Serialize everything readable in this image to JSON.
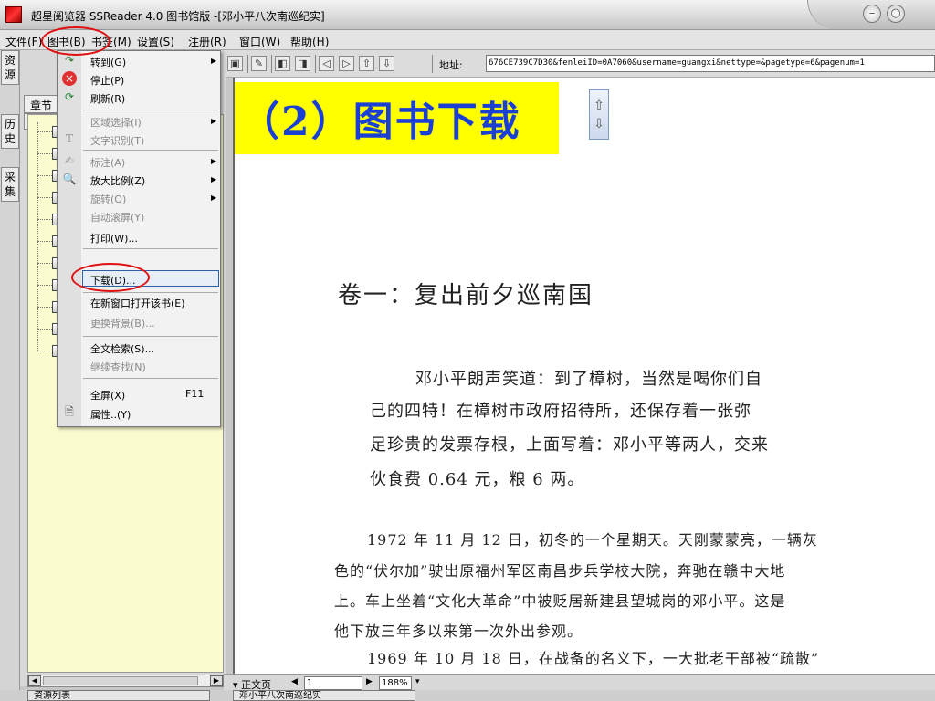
{
  "window": {
    "title": "超星阅览器 SSReader 4.0 图书馆版 -[邓小平八次南巡纪实]"
  },
  "menubar": {
    "items": [
      "文件(F)",
      "图书(B)",
      "书签(M)",
      "设置(S)",
      "注册(R)",
      "窗口(W)",
      "帮助(H)"
    ]
  },
  "toolbar": {
    "address_label": "地址:",
    "address_value": "676CE739C7D30&fenleiID=0A7060&username=guangxi&nettype=&pagetype=6&pagenum=1"
  },
  "left_strip": {
    "tabs": [
      "资源",
      "历史",
      "采集"
    ]
  },
  "left_panel": {
    "tab_label": "章节",
    "tab_label_2": "章节"
  },
  "dropdown": {
    "items": [
      {
        "label": "转到(G)",
        "disabled": false,
        "submenu": true,
        "icon": "go-to-icon"
      },
      {
        "label": "停止(P)",
        "disabled": false,
        "submenu": false,
        "icon": "stop-icon"
      },
      {
        "label": "刷新(R)",
        "disabled": false,
        "submenu": false,
        "icon": "refresh-icon"
      },
      {
        "label": "区域选择(I)",
        "disabled": true,
        "submenu": true,
        "icon": ""
      },
      {
        "label": "文字识别(T)",
        "disabled": true,
        "submenu": false,
        "icon": "text-recognition-icon"
      },
      {
        "label": "标注(A)",
        "disabled": true,
        "submenu": true,
        "icon": "annotate-icon"
      },
      {
        "label": "放大比例(Z)",
        "disabled": false,
        "submenu": true,
        "icon": "zoom-icon"
      },
      {
        "label": "旋转(O)",
        "disabled": true,
        "submenu": true,
        "icon": ""
      },
      {
        "label": "自动滚屏(Y)",
        "disabled": true,
        "submenu": false,
        "icon": ""
      },
      {
        "label": "打印(W)...",
        "disabled": false,
        "submenu": false,
        "icon": ""
      },
      {
        "label": "下载(D)...",
        "disabled": false,
        "submenu": false,
        "icon": ""
      },
      {
        "label": "在新窗口打开该书(E)",
        "disabled": false,
        "submenu": false,
        "icon": ""
      },
      {
        "label": "更换背景(B)...",
        "disabled": true,
        "submenu": false,
        "icon": ""
      },
      {
        "label": "全文检索(S)...",
        "disabled": false,
        "submenu": false,
        "icon": ""
      },
      {
        "label": "继续查找(N)",
        "disabled": true,
        "submenu": false,
        "icon": ""
      },
      {
        "label": "全屏(X)",
        "disabled": false,
        "submenu": false,
        "icon": "",
        "shortcut": "F11"
      },
      {
        "label": "属性..(Y)",
        "disabled": false,
        "submenu": false,
        "icon": "properties-icon"
      }
    ]
  },
  "document": {
    "banner": "（2）图书下载",
    "heading": "卷一：复出前夕巡南国",
    "para1": [
      "邓小平朗声笑道：到了樟树，当然是喝你们自",
      "己的四特！在樟树市政府招待所，还保存着一张弥",
      "足珍贵的发票存根，上面写着：邓小平等两人，交来",
      "伙食费 0.64 元，粮 6 两。"
    ],
    "para2": [
      "1972 年 11 月 12 日，初冬的一个星期天。天刚蒙蒙亮，一辆灰",
      "色的“伏尔加”驶出原福州军区南昌步兵学校大院，奔驰在赣中大地",
      "上。车上坐着“文化大革命”中被贬居新建县望城岗的邓小平。这是",
      "他下放三年多以来第一次外出参观。",
      "1969 年 10 月 18 日，在战备的名义下，一大批老干部被“疏散”"
    ]
  },
  "statusbar": {
    "section": "▾ 正文页",
    "page_value": "1",
    "zoom": "188%"
  },
  "bottom_tabs": {
    "left": "资源列表",
    "right": "邓小平八次南巡纪实"
  },
  "colors": {
    "banner_bg": "#ffff00",
    "banner_text": "#1a3fd4",
    "annotation_red": "#e01010",
    "tree_bg": "#fbfbd0"
  }
}
